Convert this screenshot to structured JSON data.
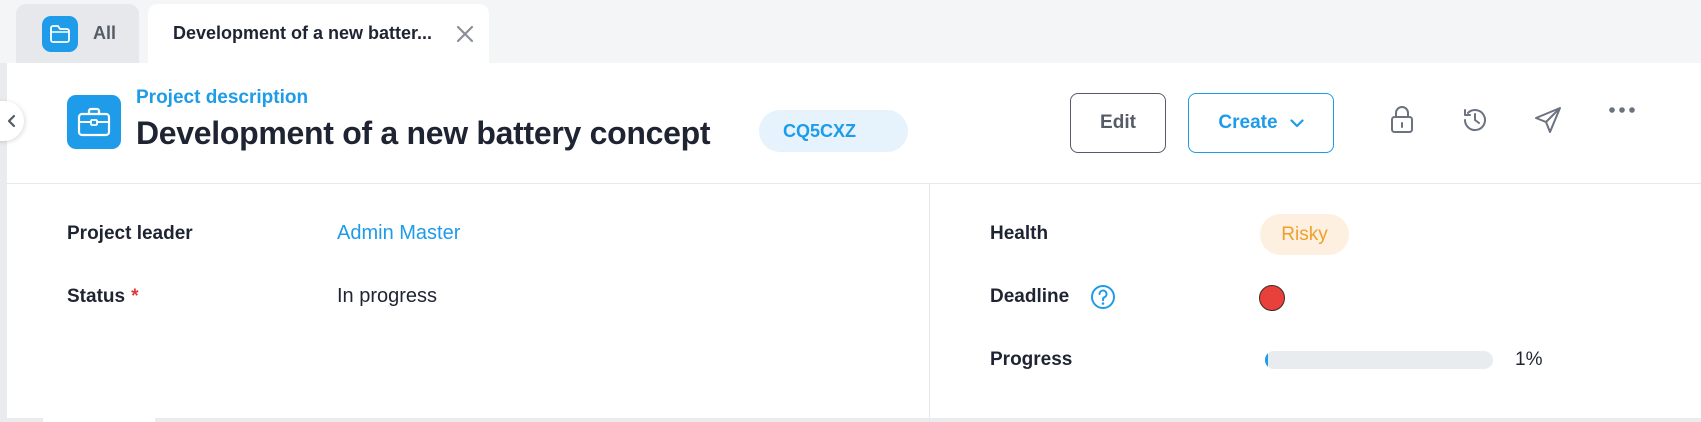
{
  "tabs": [
    {
      "label": "All",
      "icon": "folder-icon"
    },
    {
      "label": "Development of a new batter...",
      "icon": "close-icon"
    }
  ],
  "header": {
    "subtitle": "Project description",
    "title": "Development of a new battery concept",
    "code": "CQ5CXZ",
    "edit_label": "Edit",
    "create_label": "Create",
    "icons": [
      "lock-icon",
      "history-icon",
      "send-icon",
      "more-icon"
    ]
  },
  "fields": {
    "project_leader": {
      "label": "Project leader",
      "value": "Admin Master"
    },
    "status": {
      "label": "Status",
      "required_mark": "*",
      "value": "In progress"
    },
    "health": {
      "label": "Health",
      "value": "Risky"
    },
    "deadline": {
      "label": "Deadline",
      "indicator_color": "#e8403a"
    },
    "progress": {
      "label": "Progress",
      "value": 1,
      "text": "1%"
    }
  },
  "colors": {
    "accent": "#1e9be9",
    "risky_text": "#f0a02a",
    "risky_bg": "#fdf0e0",
    "required": "#e0383a"
  }
}
